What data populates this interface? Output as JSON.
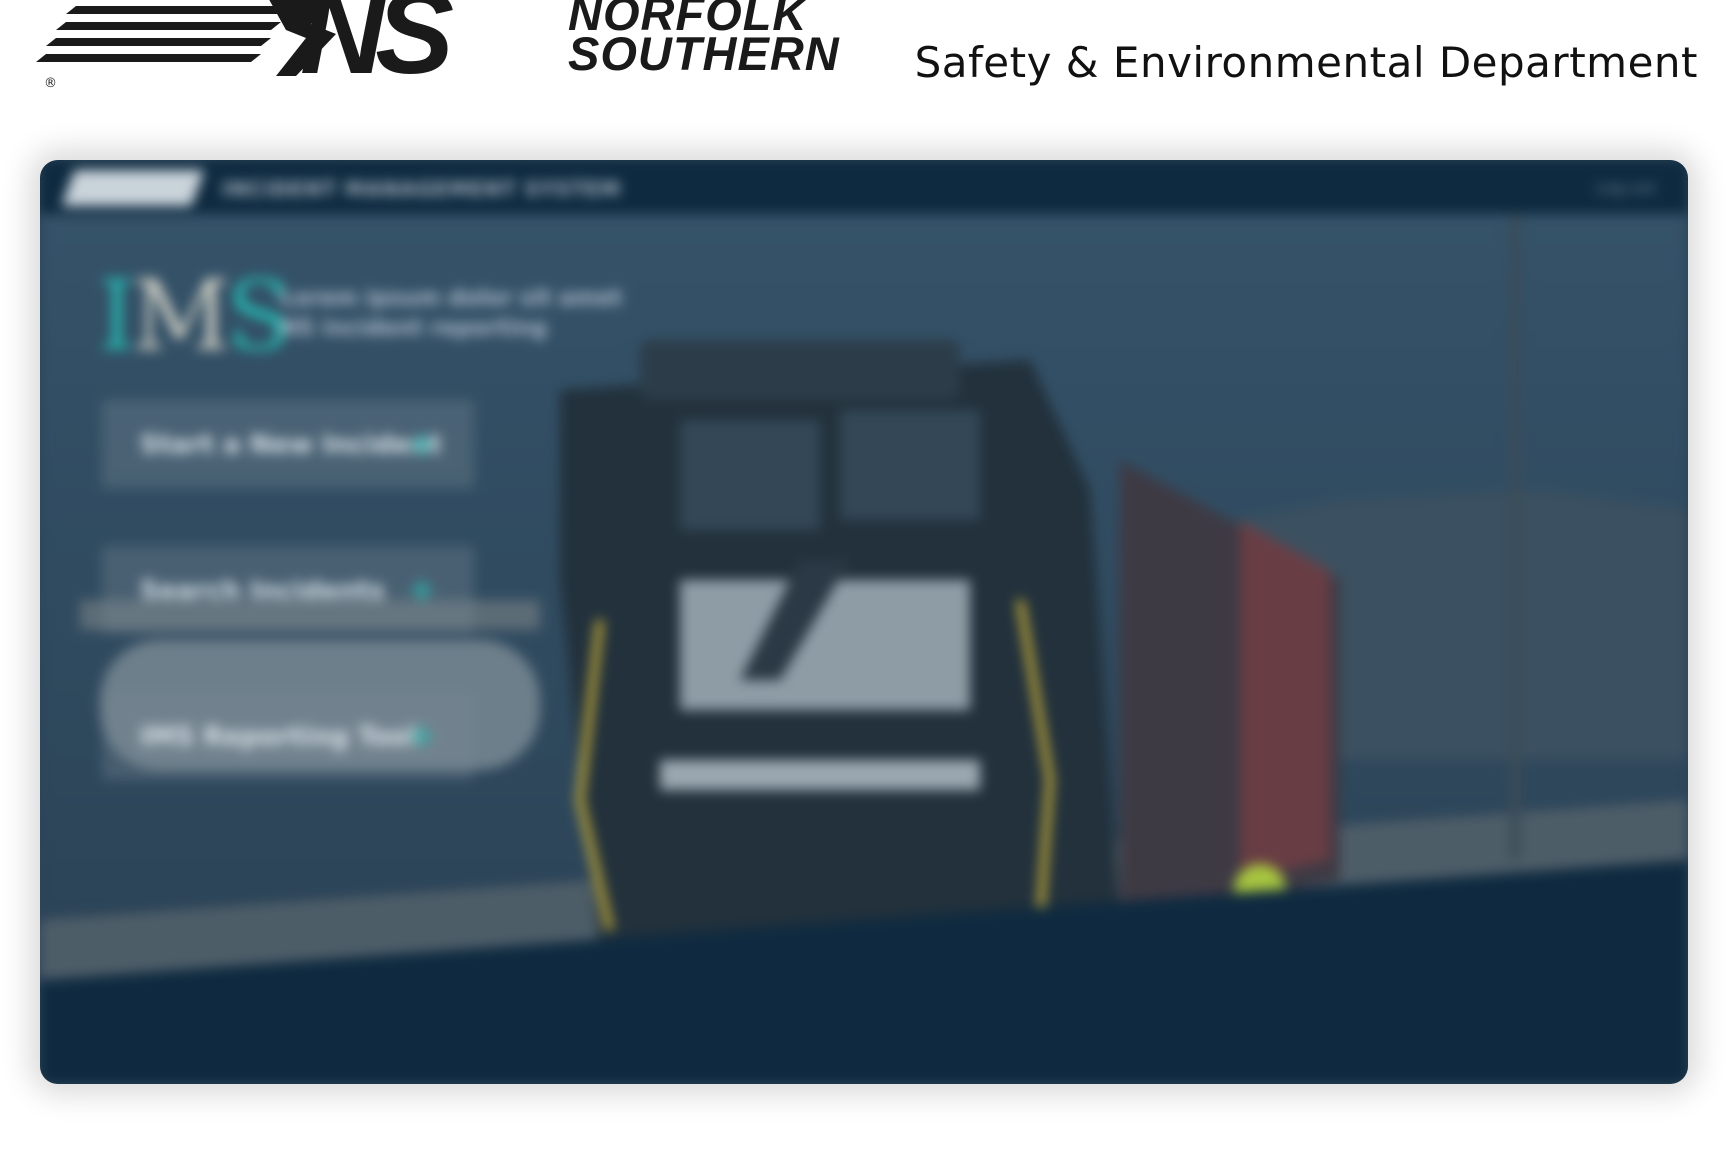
{
  "header": {
    "logo_letters": "NS",
    "logo_word_1": "NORFOLK",
    "logo_word_2": "SOUTHERN",
    "registered_mark": "®",
    "department": "Safety & Environmental Department"
  },
  "preview": {
    "topbar_title": "INCIDENT MANAGEMENT SYSTEM",
    "topbar_right": "Log out",
    "ims": {
      "i": "I",
      "m": "M",
      "s": "S",
      "tagline_line1": "Lorem ipsum dolor sit amet",
      "tagline_line2": "NS incident reporting"
    },
    "menu": [
      {
        "label": "Start a New Incident",
        "icon": "plus-icon"
      },
      {
        "label": "Search Incidents",
        "icon": "plus-icon"
      },
      {
        "label": "IMS Reporting Tool",
        "icon": "plus-icon"
      }
    ]
  },
  "colors": {
    "accent_teal": "#27b3ad",
    "topbar_navy": "#0e2a40",
    "overlay_blue": "#2b4357"
  }
}
